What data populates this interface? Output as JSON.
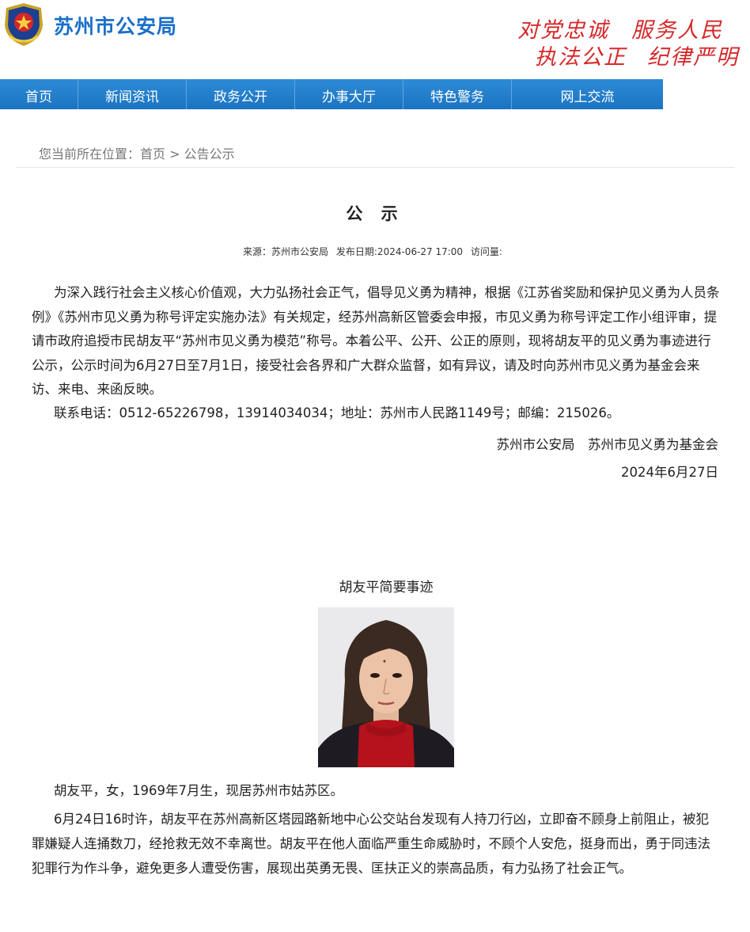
{
  "header": {
    "site_title": "苏州市公安局",
    "slogans": [
      "对党忠诚",
      "服务人民",
      "执法公正",
      "纪律严明"
    ]
  },
  "nav": {
    "items": [
      {
        "label": "首页"
      },
      {
        "label": "新闻资讯"
      },
      {
        "label": "政务公开"
      },
      {
        "label": "办事大厅"
      },
      {
        "label": "特色警务"
      },
      {
        "label": "网上交流"
      }
    ]
  },
  "breadcrumb": {
    "text": "您当前所在位置：首页 > 公告公示"
  },
  "article": {
    "title": "公 示",
    "meta": {
      "source": "来源：苏州市公安局",
      "date": "发布日期:2024-06-27 17:00",
      "views": "访问量:"
    },
    "paragraph1": "为深入践行社会主义核心价值观，大力弘扬社会正气，倡导见义勇为精神，根据《江苏省奖励和保护见义勇为人员条例》《苏州市见义勇为称号评定实施办法》有关规定，经苏州高新区管委会申报，市见义勇为称号评定工作小组评审，提请市政府追授市民胡友平“苏州市见义勇为模范”称号。本着公平、公开、公正的原则，现将胡友平的见义勇为事迹进行公示，公示时间为6月27日至7月1日，接受社会各界和广大群众监督，如有异议，请及时向苏州市见义勇为基金会来访、来电、来函反映。",
    "contact": "联系电话：0512-65226798，13914034034；地址：苏州市人民路1149号；邮编：215026。",
    "signature": "苏州市公安局　苏州市见义勇为基金会",
    "sign_date": "2024年6月27日",
    "subtitle": "胡友平简要事迹",
    "bio": "胡友平，女，1969年7月生，现居苏州市姑苏区。",
    "story": "6月24日16时许，胡友平在苏州高新区塔园路新地中心公交站台发现有人持刀行凶，立即奋不顾身上前阻止，被犯罪嫌疑人连捅数刀，经抢救无效不幸离世。胡友平在他人面临严重生命威胁时，不顾个人安危，挺身而出，勇于同违法犯罪行为作斗争，避免更多人遭受伤害，展现出英勇无畏、匡扶正义的崇高品质，有力弘扬了社会正气。"
  },
  "colors": {
    "brand_blue": "#1b6fc9",
    "nav_blue": "#1b74c1",
    "slogan_red": "#d6282a"
  },
  "icons": {
    "emblem": "police-emblem-icon",
    "photo": "portrait-photo"
  }
}
